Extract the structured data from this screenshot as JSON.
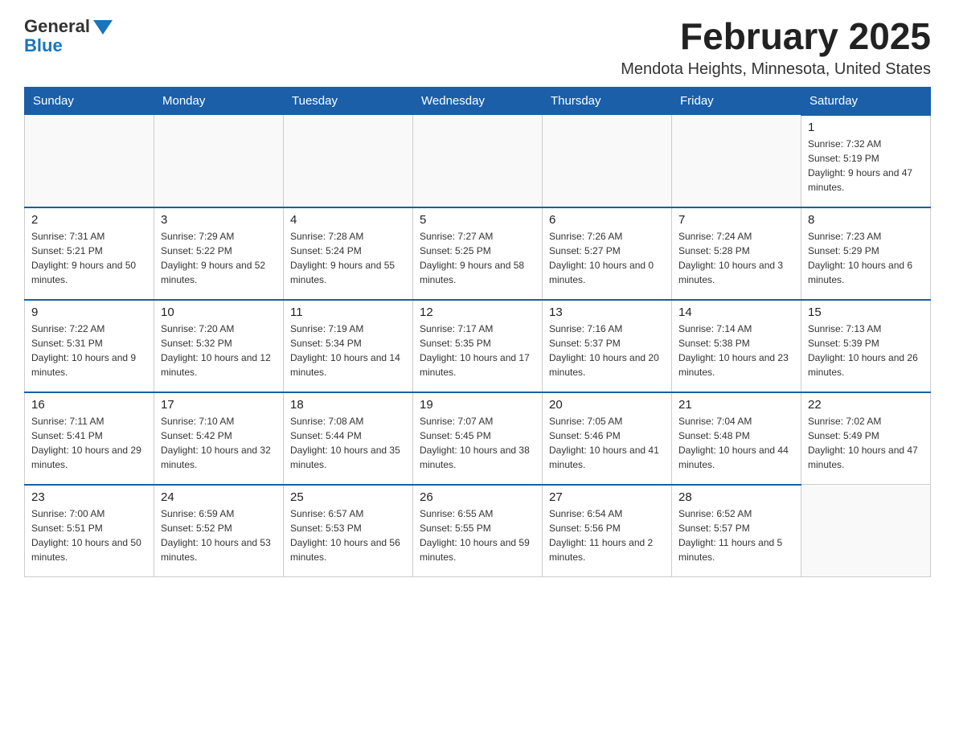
{
  "logo": {
    "general": "General",
    "blue": "Blue"
  },
  "header": {
    "title": "February 2025",
    "location": "Mendota Heights, Minnesota, United States"
  },
  "days_of_week": [
    "Sunday",
    "Monday",
    "Tuesday",
    "Wednesday",
    "Thursday",
    "Friday",
    "Saturday"
  ],
  "weeks": [
    [
      {
        "day": "",
        "info": ""
      },
      {
        "day": "",
        "info": ""
      },
      {
        "day": "",
        "info": ""
      },
      {
        "day": "",
        "info": ""
      },
      {
        "day": "",
        "info": ""
      },
      {
        "day": "",
        "info": ""
      },
      {
        "day": "1",
        "info": "Sunrise: 7:32 AM\nSunset: 5:19 PM\nDaylight: 9 hours and 47 minutes."
      }
    ],
    [
      {
        "day": "2",
        "info": "Sunrise: 7:31 AM\nSunset: 5:21 PM\nDaylight: 9 hours and 50 minutes."
      },
      {
        "day": "3",
        "info": "Sunrise: 7:29 AM\nSunset: 5:22 PM\nDaylight: 9 hours and 52 minutes."
      },
      {
        "day": "4",
        "info": "Sunrise: 7:28 AM\nSunset: 5:24 PM\nDaylight: 9 hours and 55 minutes."
      },
      {
        "day": "5",
        "info": "Sunrise: 7:27 AM\nSunset: 5:25 PM\nDaylight: 9 hours and 58 minutes."
      },
      {
        "day": "6",
        "info": "Sunrise: 7:26 AM\nSunset: 5:27 PM\nDaylight: 10 hours and 0 minutes."
      },
      {
        "day": "7",
        "info": "Sunrise: 7:24 AM\nSunset: 5:28 PM\nDaylight: 10 hours and 3 minutes."
      },
      {
        "day": "8",
        "info": "Sunrise: 7:23 AM\nSunset: 5:29 PM\nDaylight: 10 hours and 6 minutes."
      }
    ],
    [
      {
        "day": "9",
        "info": "Sunrise: 7:22 AM\nSunset: 5:31 PM\nDaylight: 10 hours and 9 minutes."
      },
      {
        "day": "10",
        "info": "Sunrise: 7:20 AM\nSunset: 5:32 PM\nDaylight: 10 hours and 12 minutes."
      },
      {
        "day": "11",
        "info": "Sunrise: 7:19 AM\nSunset: 5:34 PM\nDaylight: 10 hours and 14 minutes."
      },
      {
        "day": "12",
        "info": "Sunrise: 7:17 AM\nSunset: 5:35 PM\nDaylight: 10 hours and 17 minutes."
      },
      {
        "day": "13",
        "info": "Sunrise: 7:16 AM\nSunset: 5:37 PM\nDaylight: 10 hours and 20 minutes."
      },
      {
        "day": "14",
        "info": "Sunrise: 7:14 AM\nSunset: 5:38 PM\nDaylight: 10 hours and 23 minutes."
      },
      {
        "day": "15",
        "info": "Sunrise: 7:13 AM\nSunset: 5:39 PM\nDaylight: 10 hours and 26 minutes."
      }
    ],
    [
      {
        "day": "16",
        "info": "Sunrise: 7:11 AM\nSunset: 5:41 PM\nDaylight: 10 hours and 29 minutes."
      },
      {
        "day": "17",
        "info": "Sunrise: 7:10 AM\nSunset: 5:42 PM\nDaylight: 10 hours and 32 minutes."
      },
      {
        "day": "18",
        "info": "Sunrise: 7:08 AM\nSunset: 5:44 PM\nDaylight: 10 hours and 35 minutes."
      },
      {
        "day": "19",
        "info": "Sunrise: 7:07 AM\nSunset: 5:45 PM\nDaylight: 10 hours and 38 minutes."
      },
      {
        "day": "20",
        "info": "Sunrise: 7:05 AM\nSunset: 5:46 PM\nDaylight: 10 hours and 41 minutes."
      },
      {
        "day": "21",
        "info": "Sunrise: 7:04 AM\nSunset: 5:48 PM\nDaylight: 10 hours and 44 minutes."
      },
      {
        "day": "22",
        "info": "Sunrise: 7:02 AM\nSunset: 5:49 PM\nDaylight: 10 hours and 47 minutes."
      }
    ],
    [
      {
        "day": "23",
        "info": "Sunrise: 7:00 AM\nSunset: 5:51 PM\nDaylight: 10 hours and 50 minutes."
      },
      {
        "day": "24",
        "info": "Sunrise: 6:59 AM\nSunset: 5:52 PM\nDaylight: 10 hours and 53 minutes."
      },
      {
        "day": "25",
        "info": "Sunrise: 6:57 AM\nSunset: 5:53 PM\nDaylight: 10 hours and 56 minutes."
      },
      {
        "day": "26",
        "info": "Sunrise: 6:55 AM\nSunset: 5:55 PM\nDaylight: 10 hours and 59 minutes."
      },
      {
        "day": "27",
        "info": "Sunrise: 6:54 AM\nSunset: 5:56 PM\nDaylight: 11 hours and 2 minutes."
      },
      {
        "day": "28",
        "info": "Sunrise: 6:52 AM\nSunset: 5:57 PM\nDaylight: 11 hours and 5 minutes."
      },
      {
        "day": "",
        "info": ""
      }
    ]
  ]
}
